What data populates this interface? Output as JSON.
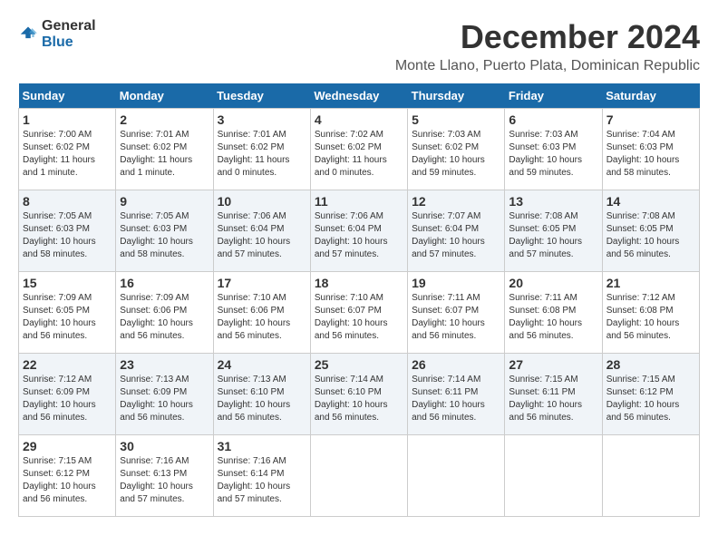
{
  "header": {
    "logo": {
      "general": "General",
      "blue": "Blue"
    },
    "title": "December 2024",
    "location": "Monte Llano, Puerto Plata, Dominican Republic"
  },
  "calendar": {
    "weekdays": [
      "Sunday",
      "Monday",
      "Tuesday",
      "Wednesday",
      "Thursday",
      "Friday",
      "Saturday"
    ],
    "weeks": [
      [
        {
          "day": "1",
          "sunrise": "7:00 AM",
          "sunset": "6:02 PM",
          "daylight": "11 hours and 1 minute."
        },
        {
          "day": "2",
          "sunrise": "7:01 AM",
          "sunset": "6:02 PM",
          "daylight": "11 hours and 1 minute."
        },
        {
          "day": "3",
          "sunrise": "7:01 AM",
          "sunset": "6:02 PM",
          "daylight": "11 hours and 0 minutes."
        },
        {
          "day": "4",
          "sunrise": "7:02 AM",
          "sunset": "6:02 PM",
          "daylight": "11 hours and 0 minutes."
        },
        {
          "day": "5",
          "sunrise": "7:03 AM",
          "sunset": "6:02 PM",
          "daylight": "10 hours and 59 minutes."
        },
        {
          "day": "6",
          "sunrise": "7:03 AM",
          "sunset": "6:03 PM",
          "daylight": "10 hours and 59 minutes."
        },
        {
          "day": "7",
          "sunrise": "7:04 AM",
          "sunset": "6:03 PM",
          "daylight": "10 hours and 58 minutes."
        }
      ],
      [
        {
          "day": "8",
          "sunrise": "7:05 AM",
          "sunset": "6:03 PM",
          "daylight": "10 hours and 58 minutes."
        },
        {
          "day": "9",
          "sunrise": "7:05 AM",
          "sunset": "6:03 PM",
          "daylight": "10 hours and 58 minutes."
        },
        {
          "day": "10",
          "sunrise": "7:06 AM",
          "sunset": "6:04 PM",
          "daylight": "10 hours and 57 minutes."
        },
        {
          "day": "11",
          "sunrise": "7:06 AM",
          "sunset": "6:04 PM",
          "daylight": "10 hours and 57 minutes."
        },
        {
          "day": "12",
          "sunrise": "7:07 AM",
          "sunset": "6:04 PM",
          "daylight": "10 hours and 57 minutes."
        },
        {
          "day": "13",
          "sunrise": "7:08 AM",
          "sunset": "6:05 PM",
          "daylight": "10 hours and 57 minutes."
        },
        {
          "day": "14",
          "sunrise": "7:08 AM",
          "sunset": "6:05 PM",
          "daylight": "10 hours and 56 minutes."
        }
      ],
      [
        {
          "day": "15",
          "sunrise": "7:09 AM",
          "sunset": "6:05 PM",
          "daylight": "10 hours and 56 minutes."
        },
        {
          "day": "16",
          "sunrise": "7:09 AM",
          "sunset": "6:06 PM",
          "daylight": "10 hours and 56 minutes."
        },
        {
          "day": "17",
          "sunrise": "7:10 AM",
          "sunset": "6:06 PM",
          "daylight": "10 hours and 56 minutes."
        },
        {
          "day": "18",
          "sunrise": "7:10 AM",
          "sunset": "6:07 PM",
          "daylight": "10 hours and 56 minutes."
        },
        {
          "day": "19",
          "sunrise": "7:11 AM",
          "sunset": "6:07 PM",
          "daylight": "10 hours and 56 minutes."
        },
        {
          "day": "20",
          "sunrise": "7:11 AM",
          "sunset": "6:08 PM",
          "daylight": "10 hours and 56 minutes."
        },
        {
          "day": "21",
          "sunrise": "7:12 AM",
          "sunset": "6:08 PM",
          "daylight": "10 hours and 56 minutes."
        }
      ],
      [
        {
          "day": "22",
          "sunrise": "7:12 AM",
          "sunset": "6:09 PM",
          "daylight": "10 hours and 56 minutes."
        },
        {
          "day": "23",
          "sunrise": "7:13 AM",
          "sunset": "6:09 PM",
          "daylight": "10 hours and 56 minutes."
        },
        {
          "day": "24",
          "sunrise": "7:13 AM",
          "sunset": "6:10 PM",
          "daylight": "10 hours and 56 minutes."
        },
        {
          "day": "25",
          "sunrise": "7:14 AM",
          "sunset": "6:10 PM",
          "daylight": "10 hours and 56 minutes."
        },
        {
          "day": "26",
          "sunrise": "7:14 AM",
          "sunset": "6:11 PM",
          "daylight": "10 hours and 56 minutes."
        },
        {
          "day": "27",
          "sunrise": "7:15 AM",
          "sunset": "6:11 PM",
          "daylight": "10 hours and 56 minutes."
        },
        {
          "day": "28",
          "sunrise": "7:15 AM",
          "sunset": "6:12 PM",
          "daylight": "10 hours and 56 minutes."
        }
      ],
      [
        {
          "day": "29",
          "sunrise": "7:15 AM",
          "sunset": "6:12 PM",
          "daylight": "10 hours and 56 minutes."
        },
        {
          "day": "30",
          "sunrise": "7:16 AM",
          "sunset": "6:13 PM",
          "daylight": "10 hours and 57 minutes."
        },
        {
          "day": "31",
          "sunrise": "7:16 AM",
          "sunset": "6:14 PM",
          "daylight": "10 hours and 57 minutes."
        },
        null,
        null,
        null,
        null
      ]
    ]
  }
}
